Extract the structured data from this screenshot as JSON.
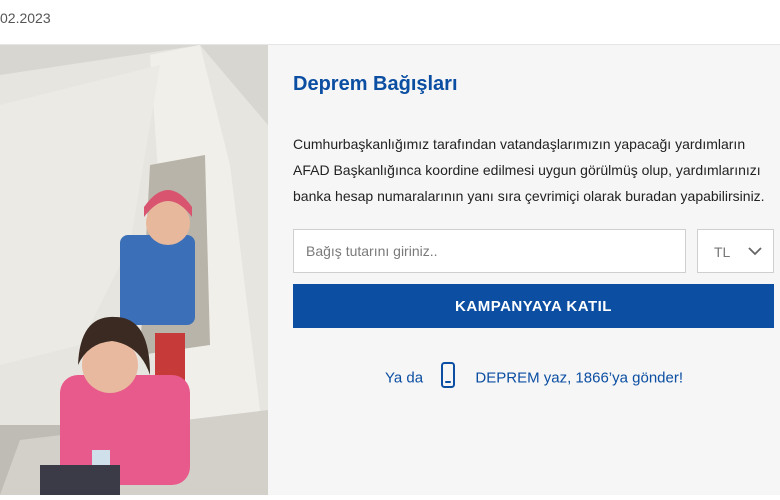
{
  "header": {
    "date_text": "02.2023"
  },
  "donation": {
    "title": "Deprem Bağışları",
    "description": "Cumhurbaşkanlığımız tarafından vatandaşlarımızın yapacağı yardımların AFAD Başkanlığınca koordine edilmesi uygun görülmüş olup, yardımlarınızı banka hesap numaralarının yanı sıra çevrimiçi olarak buradan yapabilirsiniz.",
    "amount_placeholder": "Bağış tutarını giriniz..",
    "currency_selected": "TL",
    "cta_label": "KAMPANYAYA KATIL",
    "sms_prefix": "Ya da",
    "sms_text": "DEPREM yaz, 1866’ya gönder!",
    "sms_icon": "mobile-phone-icon"
  },
  "colors": {
    "brand_blue": "#0b4ea2",
    "panel_bg": "#f6f6f6"
  }
}
